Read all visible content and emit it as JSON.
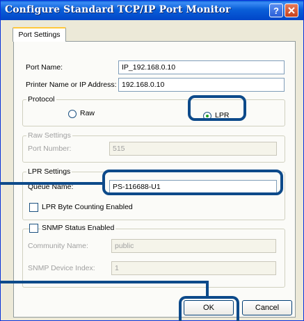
{
  "window": {
    "title": "Configure Standard TCP/IP Port Monitor",
    "help_icon": "question-mark-icon",
    "close_icon": "close-x-icon"
  },
  "tab": {
    "label": "Port Settings"
  },
  "port_name": {
    "label": "Port Name:",
    "value": "IP_192.168.0.10"
  },
  "printer_address": {
    "label": "Printer Name or IP Address:",
    "value": "192.168.0.10"
  },
  "protocol": {
    "title": "Protocol",
    "raw_label": "Raw",
    "lpr_label": "LPR",
    "selected": "LPR"
  },
  "raw_settings": {
    "title": "Raw Settings",
    "port_number_label": "Port Number:",
    "port_number_value": "515"
  },
  "lpr_settings": {
    "title": "LPR Settings",
    "queue_name_label": "Queue Name:",
    "queue_name_value": "PS-116688-U1",
    "byte_counting_label": "LPR Byte Counting Enabled"
  },
  "snmp": {
    "title": "SNMP Status Enabled",
    "community_label": "Community Name:",
    "community_value": "public",
    "device_index_label": "SNMP Device Index:",
    "device_index_value": "1"
  },
  "buttons": {
    "ok": "OK",
    "cancel": "Cancel"
  },
  "colors": {
    "callout": "#0d4a8a",
    "titlebar": "#0a5fd8"
  }
}
